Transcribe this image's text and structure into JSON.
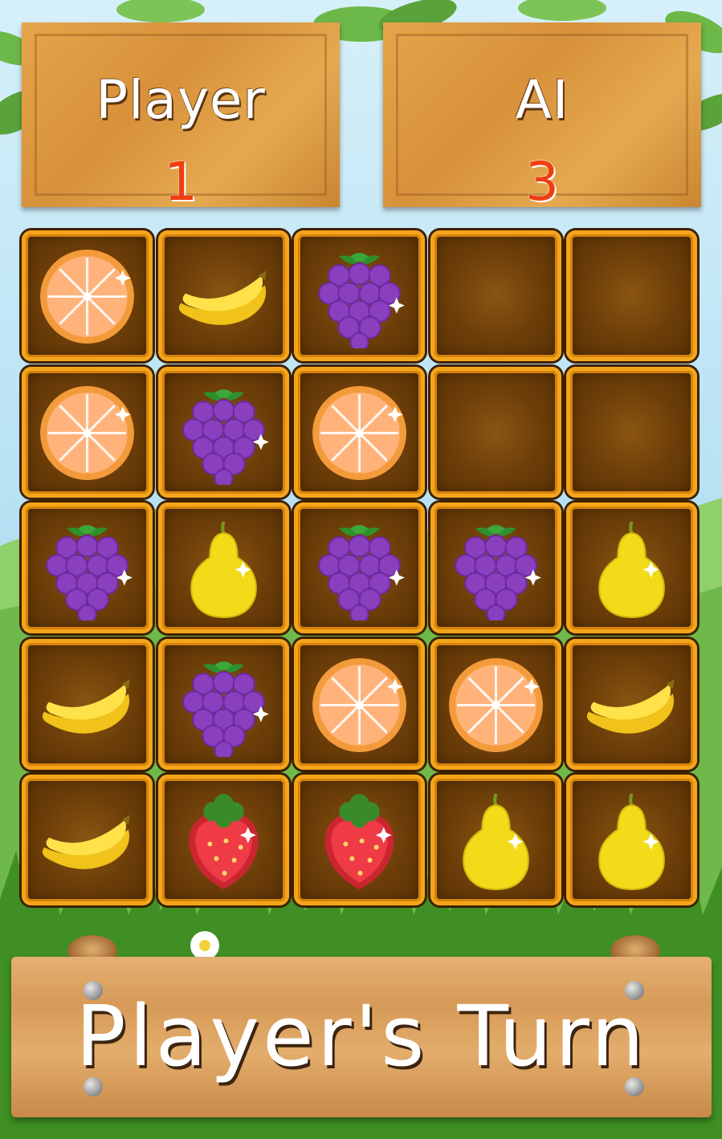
{
  "scoreboard": {
    "player_label": "Player",
    "player_score": "1",
    "ai_label": "AI",
    "ai_score": "3"
  },
  "board": {
    "rows": 5,
    "cols": 5,
    "cells": [
      [
        "orange",
        "banana",
        "grape",
        "empty",
        "empty"
      ],
      [
        "orange",
        "grape",
        "orange",
        "empty",
        "empty"
      ],
      [
        "grape",
        "pear",
        "grape",
        "grape",
        "pear"
      ],
      [
        "banana",
        "grape",
        "orange",
        "orange",
        "banana"
      ],
      [
        "banana",
        "strawberry",
        "strawberry",
        "pear",
        "pear"
      ]
    ]
  },
  "status": {
    "turn_text": "Player's Turn"
  },
  "colors": {
    "score_red": "#ef3f12",
    "cell_border": "#f4a51b",
    "cell_bg": "#6b3d08"
  }
}
